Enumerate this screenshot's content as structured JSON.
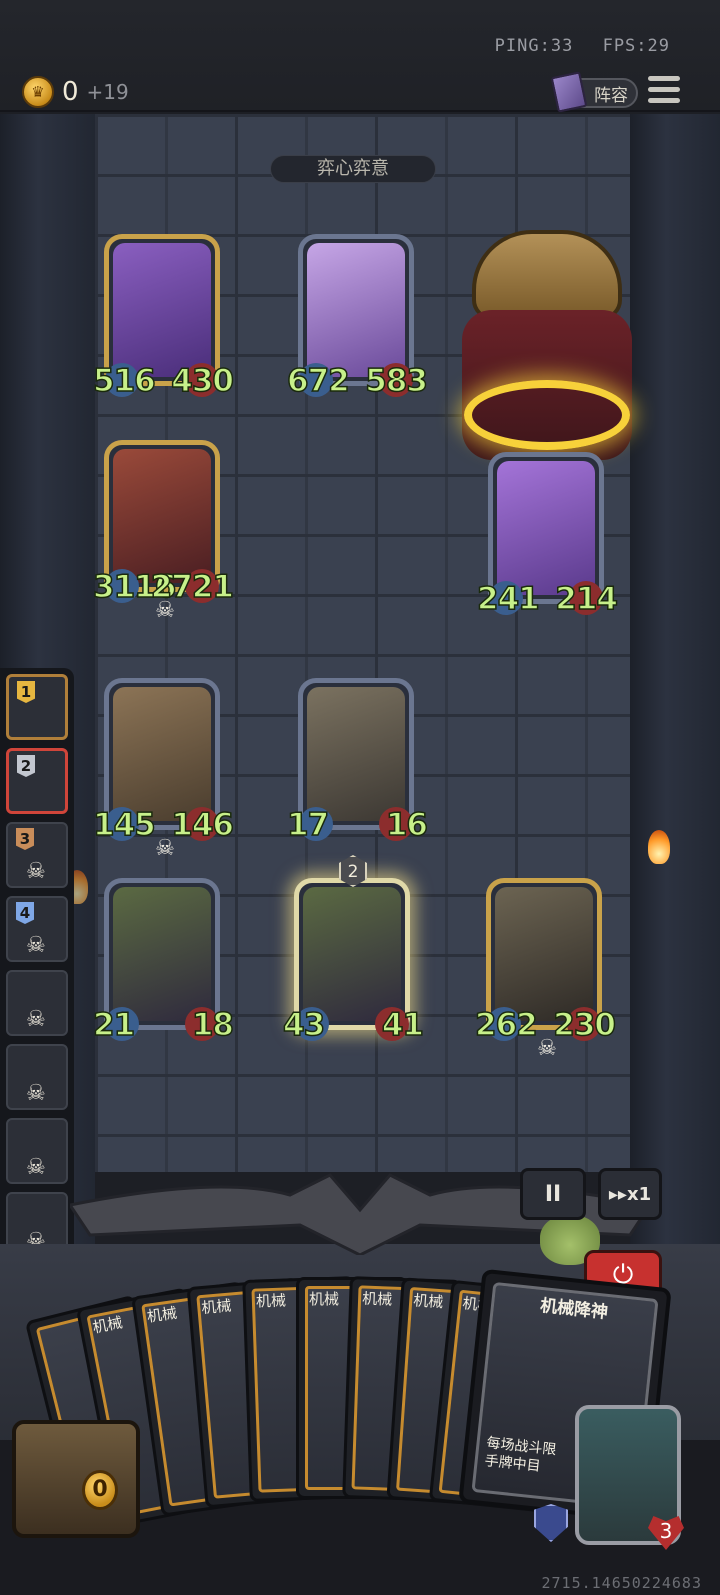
{
  "network": {
    "ping": "PING:33",
    "fps": "FPS:29"
  },
  "gold": {
    "amount": "0",
    "income": "+19"
  },
  "lineup_label": "阵容",
  "round_title": "弈心弈意",
  "enemy_board": [
    {
      "id": "sorceress",
      "atk": "516",
      "hp": "430",
      "dead": false
    },
    {
      "id": "whale",
      "atk": "672",
      "hp": "583",
      "dead": false
    },
    {
      "id": "dragon",
      "atk": "3116",
      "hp": "2721",
      "dead": true
    },
    {
      "id": "star",
      "atk": "241",
      "hp": "214",
      "dead": false
    }
  ],
  "player_board": [
    {
      "id": "mech",
      "atk": "145",
      "hp": "146",
      "dead": true
    },
    {
      "id": "rocket",
      "atk": "17",
      "hp": "16",
      "dead": false
    },
    {
      "id": "pumpkin1",
      "atk": "21",
      "hp": "18",
      "dead": false
    },
    {
      "id": "pumpkin2",
      "atk": "43",
      "hp": "41",
      "dead": false,
      "level": "2"
    },
    {
      "id": "clock",
      "atk": "262",
      "hp": "230",
      "dead": true
    }
  ],
  "rankings": [
    {
      "rank": "1",
      "color": "gold"
    },
    {
      "rank": "2",
      "color": "silver"
    },
    {
      "rank": "3",
      "color": "bronze"
    },
    {
      "rank": "4",
      "color": "blue"
    },
    {
      "rank": "",
      "color": ""
    },
    {
      "rank": "",
      "color": ""
    },
    {
      "rank": "",
      "color": ""
    },
    {
      "rank": "",
      "color": ""
    }
  ],
  "controls": {
    "pause": "II",
    "speed": "▸▸x1",
    "exit": "⏻"
  },
  "hand": {
    "card_name_short": "机械",
    "desc_short": "每场\n在\n时,",
    "lead_card": {
      "name": "机械降神",
      "desc": "每场战斗限\n手牌中目"
    }
  },
  "chest_counter": "0",
  "lives": "3",
  "seed": "2715.14650224683",
  "colors": {
    "stat_green": "#c7f08a",
    "gold_frame": "#c9a24a",
    "exit_red": "#c7312f"
  }
}
